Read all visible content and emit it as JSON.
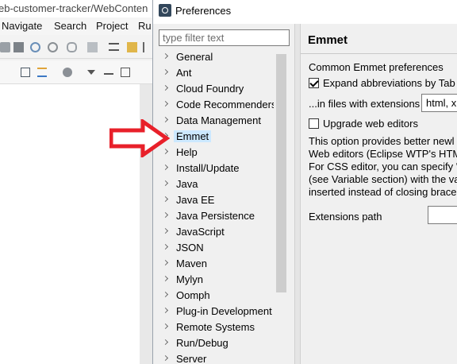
{
  "eclipse": {
    "title_fragment": "eb-customer-tracker/WebConten",
    "menus": [
      "Navigate",
      "Search",
      "Project",
      "Ru"
    ]
  },
  "dialog": {
    "title": "Preferences",
    "filter_placeholder": "type filter text",
    "tree_items": [
      {
        "label": "General"
      },
      {
        "label": "Ant"
      },
      {
        "label": "Cloud Foundry"
      },
      {
        "label": "Code Recommenders"
      },
      {
        "label": "Data Management"
      },
      {
        "label": "Emmet",
        "selected": true
      },
      {
        "label": "Help"
      },
      {
        "label": "Install/Update"
      },
      {
        "label": "Java"
      },
      {
        "label": "Java EE"
      },
      {
        "label": "Java Persistence"
      },
      {
        "label": "JavaScript"
      },
      {
        "label": "JSON"
      },
      {
        "label": "Maven"
      },
      {
        "label": "Mylyn"
      },
      {
        "label": "Oomph"
      },
      {
        "label": "Plug-in Development"
      },
      {
        "label": "Remote Systems"
      },
      {
        "label": "Run/Debug"
      },
      {
        "label": "Server"
      }
    ],
    "page": {
      "title": "Emmet",
      "subtitle": "Common Emmet preferences",
      "expand_label": "Expand abbreviations by Tab",
      "expand_checked": true,
      "extensions_label": "...in files with extensions",
      "extensions_value": "html, x",
      "upgrade_label": "Upgrade web editors",
      "upgrade_checked": false,
      "description": [
        "This option provides better newl",
        "Web editors (Eclipse WTP's HTM",
        "For CSS editor, you can specify '",
        "(see Variable section) with the va",
        "inserted instead of closing brace"
      ],
      "extensions_path_label": "Extensions path",
      "extensions_path_value": ""
    }
  },
  "annotation": {
    "arrow_color": "#e8202a"
  }
}
